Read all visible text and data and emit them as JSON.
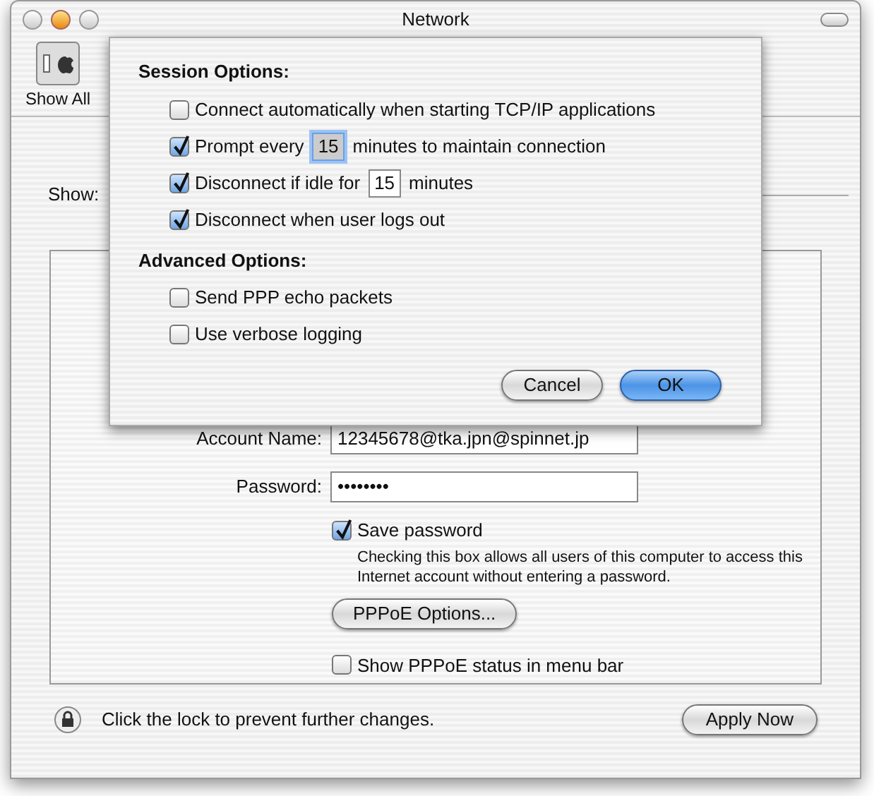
{
  "window": {
    "title": "Network"
  },
  "toolbar": {
    "items": [
      {
        "label": "Show All",
        "kind": "showall"
      }
    ]
  },
  "show": {
    "label": "Show:"
  },
  "pppoe": {
    "account_name": {
      "label": "Account Name:",
      "value": "12345678@tka.jpn@spinnet.jp"
    },
    "password": {
      "label": "Password:",
      "value": "••••••••"
    },
    "save_password": {
      "label": "Save password",
      "checked": true,
      "note": "Checking this box allows all users of this computer to access this Internet account without entering a password."
    },
    "options_button": "PPPoE Options...",
    "show_status": {
      "label": "Show PPPoE status in menu bar",
      "checked": false
    }
  },
  "lock_text": "Click the lock to prevent further changes.",
  "apply_button": "Apply Now",
  "sheet": {
    "sections": [
      {
        "title": "Session Options:",
        "items": [
          {
            "kind": "checkbox",
            "label": "Connect automatically when starting TCP/IP applications",
            "checked": false
          },
          {
            "kind": "field",
            "before": "Prompt every",
            "value": "15",
            "after": "minutes to maintain connection",
            "checked": true,
            "focused": true
          },
          {
            "kind": "field",
            "before": "Disconnect if idle for",
            "value": "15",
            "after": "minutes",
            "checked": true,
            "focused": false
          },
          {
            "kind": "checkbox",
            "label": "Disconnect when user logs out",
            "checked": true
          }
        ]
      },
      {
        "title": "Advanced Options:",
        "items": [
          {
            "kind": "checkbox",
            "label": "Send PPP echo packets",
            "checked": false
          },
          {
            "kind": "checkbox",
            "label": "Use verbose logging",
            "checked": false
          }
        ]
      }
    ],
    "buttons": [
      {
        "label": "Cancel",
        "default": false
      },
      {
        "label": "OK",
        "default": true
      }
    ]
  }
}
